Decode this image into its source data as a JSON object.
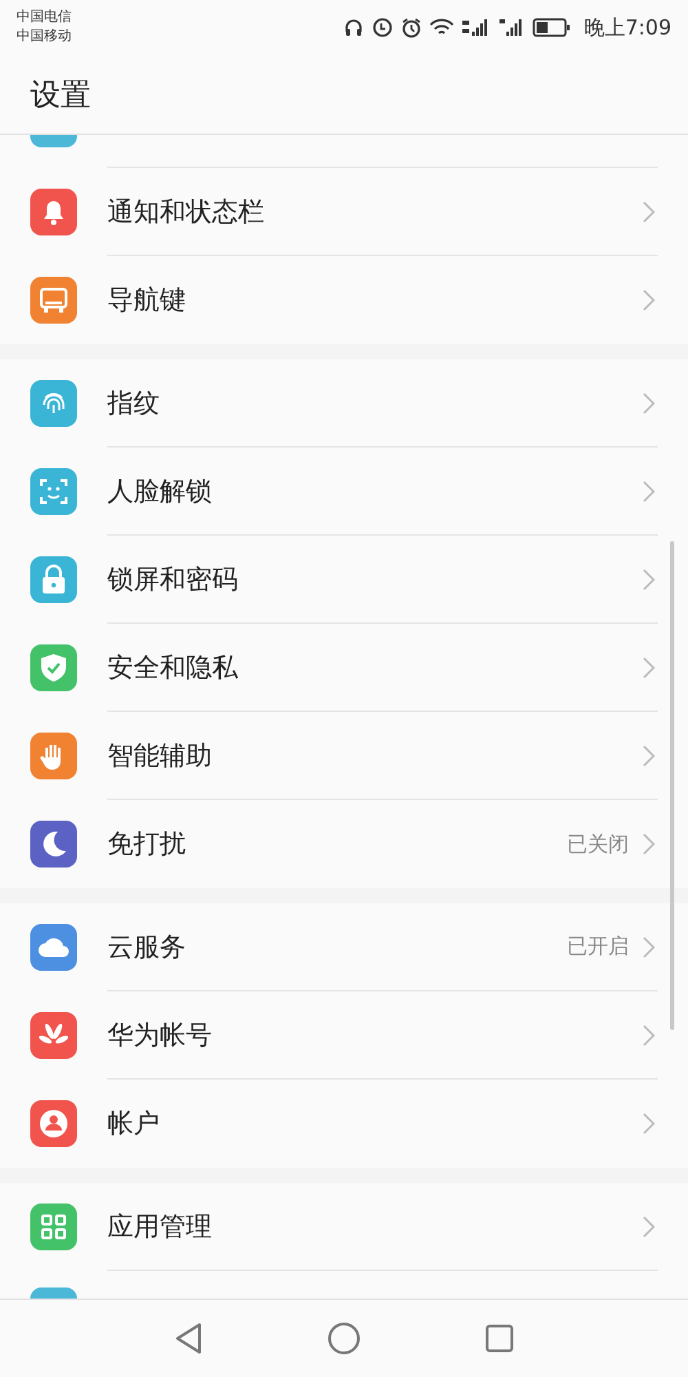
{
  "status_bar": {
    "carriers": [
      "中国电信",
      "中国移动"
    ],
    "time": "晚上7:09"
  },
  "title": "设置",
  "groups": [
    {
      "items": [
        {
          "kind": "bell",
          "color": "#f0544c",
          "label": "通知和状态栏"
        },
        {
          "kind": "navkey",
          "color": "#f08232",
          "label": "导航键"
        }
      ]
    },
    {
      "items": [
        {
          "kind": "fingerprint",
          "color": "#3bb5d6",
          "label": "指纹"
        },
        {
          "kind": "face",
          "color": "#3bb5d6",
          "label": "人脸解锁"
        },
        {
          "kind": "lock",
          "color": "#3bb5d6",
          "label": "锁屏和密码"
        },
        {
          "kind": "shield",
          "color": "#44c26a",
          "label": "安全和隐私"
        },
        {
          "kind": "hand",
          "color": "#f08232",
          "label": "智能辅助"
        },
        {
          "kind": "moon",
          "color": "#5b62c4",
          "label": "免打扰",
          "value": "已关闭"
        }
      ]
    },
    {
      "items": [
        {
          "kind": "cloud",
          "color": "#4d8fe0",
          "label": "云服务",
          "value": "已开启"
        },
        {
          "kind": "petals",
          "color": "#f0544c",
          "label": "华为帐号"
        },
        {
          "kind": "person",
          "color": "#f0544c",
          "label": "帐户"
        }
      ]
    },
    {
      "items": [
        {
          "kind": "grid",
          "color": "#44c26a",
          "label": "应用管理"
        }
      ]
    }
  ]
}
